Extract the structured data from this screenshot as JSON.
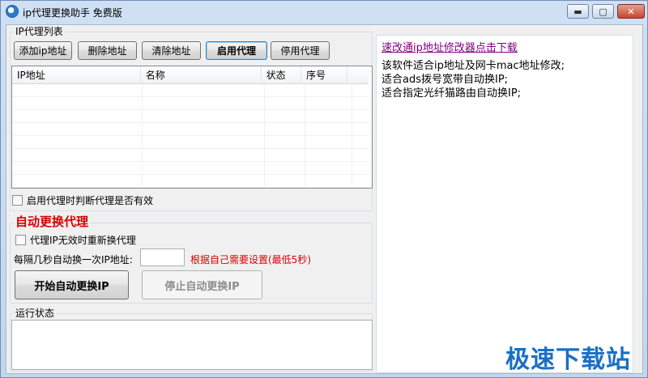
{
  "window": {
    "title": "ip代理更换助手 免费版",
    "minimize": "▬",
    "maximize": "▢",
    "close": "✕"
  },
  "proxy_list": {
    "group_label": "IP代理列表",
    "buttons": {
      "add": "添加ip地址",
      "delete": "删除地址",
      "clear": "清除地址",
      "enable": "启用代理",
      "disable": "停用代理"
    },
    "columns": [
      "IP地址",
      "名称",
      "状态",
      "序号"
    ],
    "rows": [],
    "check_valid_label": "启用代理时判断代理是否有效"
  },
  "auto_switch": {
    "title": "自动更换代理",
    "retry_label": "代理IP无效时重新换代理",
    "interval_label": "每隔几秒自动换一次IP地址:",
    "interval_value": "",
    "hint": "根据自己需要设置(最低5秒)",
    "start_button": "开始自动更换IP",
    "stop_button": "停止自动更换IP"
  },
  "log": {
    "group_label": "运行状态"
  },
  "info_panel": {
    "link": "速改通ip地址修改器点击下载",
    "lines": [
      "该软件适合ip地址及网卡mac地址修改;",
      "适合ads拨号宽带自动换IP;",
      "适合指定光纤猫路由自动换IP;"
    ]
  },
  "watermark": "极速下载站",
  "colors": {
    "accent_red": "#d80000",
    "link": "#800080",
    "watermark": "#1a6fc4"
  }
}
